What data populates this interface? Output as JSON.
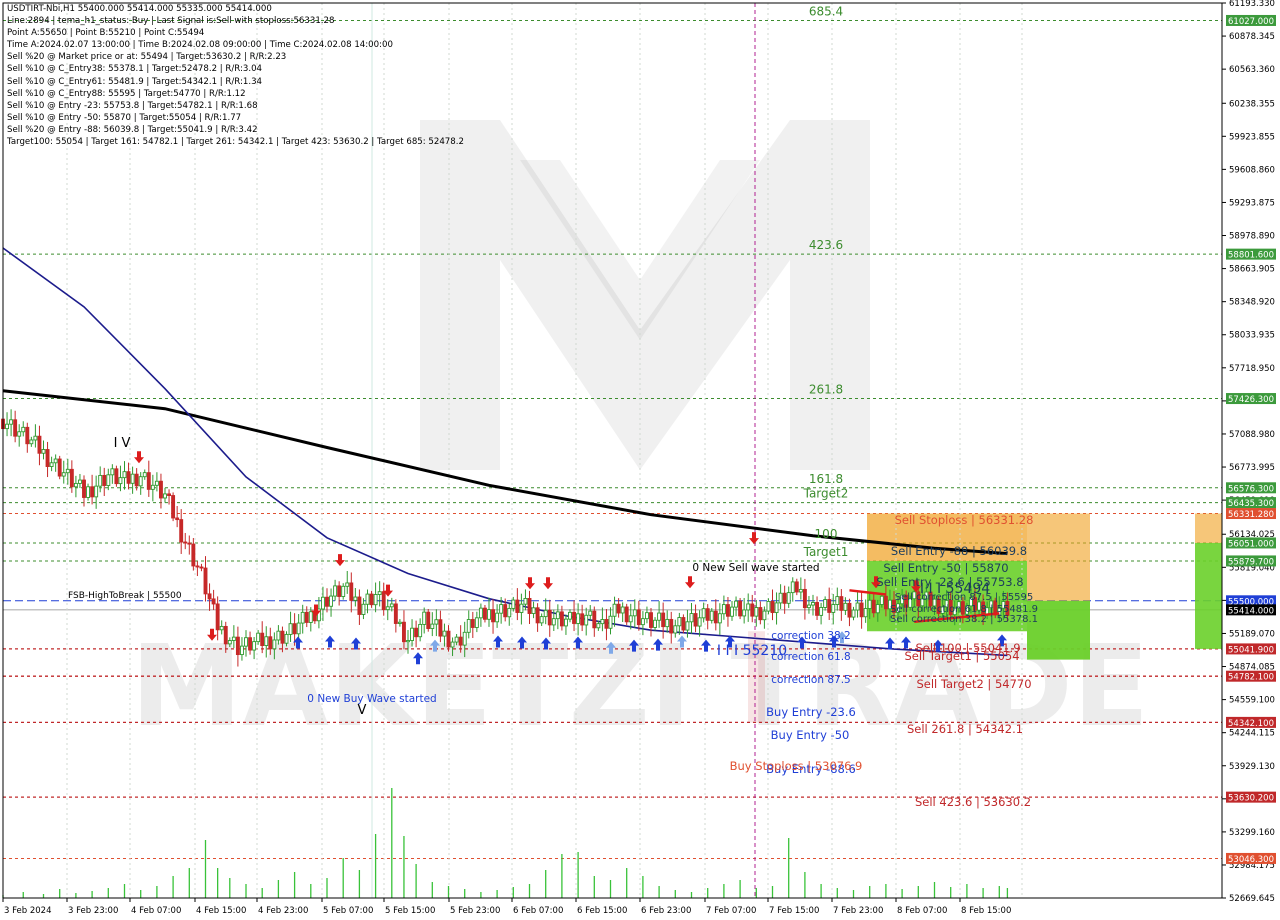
{
  "header_lines": [
    "USDTIRT-Nbi,H1  55400.000 55414.000 55335.000 55414.000",
    "Line:2894 | tema_h1_status: Buy | Last Signal is:Sell with stoploss:56331.28",
    "Point A:55650 | Point B:55210 | Point C:55494",
    "Time A:2024.02.07 13:00:00 | Time B:2024.02.08 09:00:00 | Time C:2024.02.08 14:00:00",
    "Sell %20 @ Market price or at: 55494 | Target:53630.2 | R/R:2.23",
    "Sell %10 @ C_Entry38: 55378.1 | Target:52478.2 | R/R:3.04",
    "Sell %10 @ C_Entry61: 55481.9 | Target:54342.1 | R/R:1.34",
    "Sell %10 @ C_Entry88: 55595 | Target:54770 | R/R:1.12",
    "Sell %10 @ Entry -23: 55753.8 | Target:54782.1 | R/R:1.68",
    "Sell %10 @ Entry -50: 55870 | Target:55054 | R/R:1.77",
    "Sell %20 @ Entry -88: 56039.8 | Target:55041.9 | R/R:3.42",
    "Target100: 55054 | Target 161: 54782.1 | Target 261: 54342.1 | Target 423: 53630.2 | Target 685: 52478.2"
  ],
  "price_axis": {
    "ticks": [
      "61193.330",
      "60878.345",
      "60563.360",
      "60238.355",
      "59923.855",
      "59608.860",
      "59293.875",
      "58978.890",
      "58663.905",
      "58348.920",
      "58033.935",
      "57718.950",
      "57403.965",
      "57088.980",
      "56773.995",
      "56459.010",
      "56134.025",
      "55819.040",
      "55504.055",
      "55189.070",
      "54874.085",
      "54559.100",
      "54244.115",
      "53929.130",
      "53614.145",
      "53299.160",
      "52984.175",
      "52669.645"
    ],
    "ymin": 52669.645,
    "ymax": 61193.33
  },
  "price_tags": [
    {
      "label": "61027.000",
      "value": 61027.0,
      "color": "#3c9a3c"
    },
    {
      "label": "58801.600",
      "value": 58801.6,
      "color": "#3c9a3c"
    },
    {
      "label": "57426.300",
      "value": 57426.3,
      "color": "#3c9a3c"
    },
    {
      "label": "56576.300",
      "value": 56576.3,
      "color": "#3c9a3c"
    },
    {
      "label": "56435.300",
      "value": 56435.3,
      "color": "#3c9a3c"
    },
    {
      "label": "56331.280",
      "value": 56331.28,
      "color": "#e05030"
    },
    {
      "label": "56051.000",
      "value": 56051.0,
      "color": "#3c9a3c"
    },
    {
      "label": "55879.700",
      "value": 55879.7,
      "color": "#3c9a3c"
    },
    {
      "label": "55500.000",
      "value": 55500.0,
      "color": "#1f3fd6"
    },
    {
      "label": "55414.000",
      "value": 55414.0,
      "color": "#000000"
    },
    {
      "label": "55041.900",
      "value": 55041.9,
      "color": "#c0282a"
    },
    {
      "label": "54782.100",
      "value": 54782.1,
      "color": "#c0282a"
    },
    {
      "label": "54342.100",
      "value": 54342.1,
      "color": "#c0282a"
    },
    {
      "label": "53630.200",
      "value": 53630.2,
      "color": "#c0282a"
    },
    {
      "label": "53046.300",
      "value": 53046.3,
      "color": "#e05030"
    }
  ],
  "time_axis": [
    "3 Feb 2024",
    "3 Feb 23:00",
    "4 Feb 07:00",
    "4 Feb 15:00",
    "4 Feb 23:00",
    "5 Feb 07:00",
    "5 Feb 15:00",
    "5 Feb 23:00",
    "6 Feb 07:00",
    "6 Feb 15:00",
    "6 Feb 23:00",
    "7 Feb 07:00",
    "7 Feb 15:00",
    "7 Feb 23:00",
    "8 Feb 07:00",
    "8 Feb 15:00"
  ],
  "fib_levels": [
    {
      "label": "685.4",
      "value": 61027.0
    },
    {
      "label": "423.6",
      "value": 58801.6
    },
    {
      "label": "261.8",
      "value": 57426.3
    },
    {
      "label": "161.8",
      "value": 56576.3
    },
    {
      "label": "Target2",
      "value": 56435.3
    },
    {
      "label": "100",
      "value": 56051.0
    },
    {
      "label": "Target1",
      "value": 55879.7
    }
  ],
  "annotations": {
    "wave_iv": "I V",
    "wave_v": "V",
    "fsb": "FSB-HighToBreak | 55500",
    "new_sell": "0 New Sell wave started",
    "new_buy": "0 New Buy Wave started",
    "sell_stoploss": "Sell Stoploss | 56331.28",
    "sell_entry_88": "Sell Entry -88 | 56039.8",
    "sell_entry_50": "Sell Entry -50 | 55870",
    "sell_entry_23": "Sell Entry -23.6 | 55753.8",
    "point_c": "I I I 55494",
    "sell_corr_87": "Sell correction 87.5 | 55595",
    "sell_corr_61": "Sell correction 61.8 | 55481.9",
    "sell_corr_38": "Sell correction 38.2 | 55378.1",
    "point_b": "I I I 55210",
    "corr_382": "correction 38.2",
    "corr_618": "correction 61.8",
    "corr_875": "correction 87.5",
    "sell_target1": "Sell Target1 | 55054",
    "sell_100": "Sell 100 | 55041.9",
    "sell_target2": "Sell Target2 | 54770",
    "buy_entry_23": "Buy Entry -23.6",
    "buy_entry_50": "Buy Entry -50",
    "buy_entry_88": "Buy Entry -88.6",
    "buy_stoploss": "Buy Stoploss | 53076.9",
    "sell_2618": "Sell 261.8 | 54342.1",
    "sell_4236": "Sell 423.6 | 53630.2"
  },
  "watermark": "MAKETZI TRADE",
  "colors": {
    "fib_green": "#3c8c2e",
    "red_level": "#c0282a",
    "blue_level": "#1f3fd6",
    "ma_fast": "#1c1c8c",
    "ma_slow": "#000000",
    "bull": "#2f9a2f",
    "bear": "#c62828",
    "volume": "#39c239",
    "zone_orange": "#f0a020",
    "zone_green": "#6ad02a"
  },
  "chart_data": {
    "type": "candlestick",
    "symbol": "USDTIRT-Nbi,H1",
    "ohlc_last": {
      "open": 55400.0,
      "high": 55414.0,
      "low": 55335.0,
      "close": 55414.0
    },
    "close_path": [
      [
        0,
        57230
      ],
      [
        6,
        57050
      ],
      [
        14,
        56760
      ],
      [
        20,
        56520
      ],
      [
        26,
        56700
      ],
      [
        30,
        56640
      ],
      [
        34,
        56700
      ],
      [
        40,
        56500
      ],
      [
        44,
        56150
      ],
      [
        49,
        55740
      ],
      [
        53,
        55260
      ],
      [
        58,
        55060
      ],
      [
        64,
        55110
      ],
      [
        70,
        55180
      ],
      [
        76,
        55360
      ],
      [
        80,
        55520
      ],
      [
        84,
        55620
      ],
      [
        88,
        55460
      ],
      [
        92,
        55560
      ],
      [
        96,
        55380
      ],
      [
        100,
        55140
      ],
      [
        104,
        55320
      ],
      [
        108,
        55200
      ],
      [
        112,
        55100
      ],
      [
        116,
        55300
      ],
      [
        120,
        55380
      ],
      [
        124,
        55420
      ],
      [
        128,
        55450
      ],
      [
        132,
        55380
      ],
      [
        136,
        55330
      ],
      [
        140,
        55300
      ],
      [
        144,
        55380
      ],
      [
        148,
        55250
      ],
      [
        152,
        55420
      ],
      [
        156,
        55360
      ],
      [
        160,
        55300
      ],
      [
        166,
        55280
      ],
      [
        172,
        55320
      ],
      [
        176,
        55380
      ],
      [
        180,
        55440
      ],
      [
        184,
        55380
      ],
      [
        188,
        55420
      ],
      [
        192,
        55500
      ],
      [
        196,
        55620
      ],
      [
        200,
        55430
      ],
      [
        206,
        55450
      ],
      [
        212,
        55420
      ],
      [
        218,
        55460
      ],
      [
        224,
        55520
      ],
      [
        230,
        55480
      ],
      [
        236,
        55420
      ],
      [
        242,
        55460
      ],
      [
        248,
        55414
      ]
    ],
    "ma_slow": [
      [
        0,
        57500
      ],
      [
        40,
        57330
      ],
      [
        80,
        56960
      ],
      [
        120,
        56600
      ],
      [
        160,
        56320
      ],
      [
        200,
        56120
      ],
      [
        230,
        56000
      ],
      [
        248,
        55950
      ]
    ],
    "ma_fast": [
      [
        0,
        58860
      ],
      [
        20,
        58300
      ],
      [
        40,
        57520
      ],
      [
        60,
        56680
      ],
      [
        80,
        56100
      ],
      [
        100,
        55760
      ],
      [
        120,
        55520
      ],
      [
        140,
        55350
      ],
      [
        160,
        55220
      ],
      [
        180,
        55160
      ],
      [
        200,
        55100
      ],
      [
        220,
        55040
      ],
      [
        248,
        54980
      ]
    ],
    "volume": [
      [
        0,
        3
      ],
      [
        5,
        6
      ],
      [
        10,
        4
      ],
      [
        14,
        9
      ],
      [
        18,
        5
      ],
      [
        22,
        7
      ],
      [
        26,
        10
      ],
      [
        30,
        14
      ],
      [
        34,
        8
      ],
      [
        38,
        12
      ],
      [
        42,
        22
      ],
      [
        46,
        30
      ],
      [
        50,
        58
      ],
      [
        53,
        30
      ],
      [
        56,
        20
      ],
      [
        60,
        14
      ],
      [
        64,
        10
      ],
      [
        68,
        18
      ],
      [
        72,
        26
      ],
      [
        76,
        14
      ],
      [
        80,
        20
      ],
      [
        84,
        40
      ],
      [
        88,
        28
      ],
      [
        92,
        64
      ],
      [
        96,
        110
      ],
      [
        99,
        62
      ],
      [
        102,
        34
      ],
      [
        106,
        16
      ],
      [
        110,
        12
      ],
      [
        114,
        9
      ],
      [
        118,
        6
      ],
      [
        122,
        8
      ],
      [
        126,
        11
      ],
      [
        130,
        14
      ],
      [
        134,
        28
      ],
      [
        138,
        44
      ],
      [
        142,
        46
      ],
      [
        146,
        22
      ],
      [
        150,
        18
      ],
      [
        154,
        30
      ],
      [
        158,
        22
      ],
      [
        162,
        12
      ],
      [
        166,
        8
      ],
      [
        170,
        6
      ],
      [
        174,
        10
      ],
      [
        178,
        14
      ],
      [
        182,
        18
      ],
      [
        186,
        10
      ],
      [
        190,
        12
      ],
      [
        194,
        60
      ],
      [
        198,
        26
      ],
      [
        202,
        14
      ],
      [
        206,
        10
      ],
      [
        210,
        8
      ],
      [
        214,
        12
      ],
      [
        218,
        14
      ],
      [
        222,
        9
      ],
      [
        226,
        12
      ],
      [
        230,
        16
      ],
      [
        234,
        11
      ],
      [
        238,
        14
      ],
      [
        242,
        10
      ],
      [
        246,
        12
      ],
      [
        248,
        10
      ]
    ],
    "levels": [
      {
        "name": "Sell Stoploss",
        "value": 56331.28
      },
      {
        "name": "Sell Entry -88",
        "value": 56039.8
      },
      {
        "name": "Sell Entry -50",
        "value": 55870
      },
      {
        "name": "Sell Entry -23.6",
        "value": 55753.8
      },
      {
        "name": "Point C",
        "value": 55494
      },
      {
        "name": "FSB-HighToBreak",
        "value": 55500
      },
      {
        "name": "Point B",
        "value": 55210
      },
      {
        "name": "Sell Target1",
        "value": 55054
      },
      {
        "name": "Sell 100",
        "value": 55041.9
      },
      {
        "name": "Sell Target2",
        "value": 54770
      },
      {
        "name": "Sell 261.8",
        "value": 54342.1
      },
      {
        "name": "Sell 423.6",
        "value": 53630.2
      },
      {
        "name": "Buy Stoploss",
        "value": 53076.9
      }
    ]
  }
}
